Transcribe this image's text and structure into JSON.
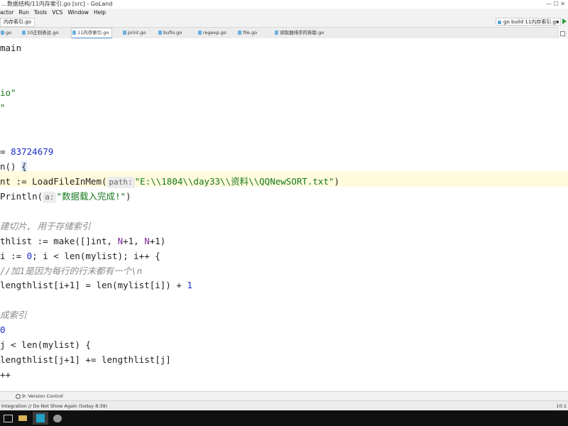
{
  "window": {
    "title": "…数据结构/11内存索引.go [src] - GoLand",
    "controls": "— ☐ ✕"
  },
  "menu": [
    "actor",
    "Run",
    "Tools",
    "VCS",
    "Window",
    "Help"
  ],
  "nav": {
    "breadcrumb": "内存索引.go",
    "run_config": "go build 11内存索引.go"
  },
  "tabs": [
    {
      "label": "go"
    },
    {
      "label": "10正则表达.go"
    },
    {
      "label": "11内存索引.go",
      "active": true
    },
    {
      "label": "print.go"
    },
    {
      "label": "bufio.go"
    },
    {
      "label": "regexp.go"
    },
    {
      "label": "file.go"
    },
    {
      "label": "读取器排序的排版.go"
    }
  ],
  "editor": {
    "lines": [
      {
        "parts": [
          {
            "t": "main"
          }
        ]
      },
      {
        "parts": []
      },
      {
        "parts": []
      },
      {
        "parts": [
          {
            "t": "io\"",
            "c": "str"
          }
        ]
      },
      {
        "parts": [
          {
            "t": "\"",
            "c": "str"
          }
        ]
      },
      {
        "parts": []
      },
      {
        "parts": []
      },
      {
        "parts": [
          {
            "t": "= "
          },
          {
            "t": "83724679",
            "c": "num"
          }
        ]
      },
      {
        "parts": [
          {
            "t": "n() "
          },
          {
            "t": "{",
            "c": "brace"
          }
        ]
      },
      {
        "parts": [
          {
            "t": "nt := LoadFileInMem("
          },
          {
            "t": "path:",
            "c": "hint"
          },
          {
            "t": "\"E:\\\\1804\\\\day33\\\\资料\\\\QQNewSORT.txt\"",
            "c": "str"
          },
          {
            "t": ")"
          }
        ]
      },
      {
        "parts": [
          {
            "t": "Println("
          },
          {
            "t": "a:",
            "c": "hint"
          },
          {
            "t": "\"数据载入完成!\"",
            "c": "str"
          },
          {
            "t": ")"
          }
        ]
      },
      {
        "parts": []
      },
      {
        "parts": [
          {
            "t": "建切片, 用于存储索引",
            "c": "cmt"
          }
        ]
      },
      {
        "parts": [
          {
            "t": "thlist := make([]int, "
          },
          {
            "t": "N",
            "c": "ident"
          },
          {
            "t": "+1, "
          },
          {
            "t": "N",
            "c": "ident"
          },
          {
            "t": "+1)"
          }
        ]
      },
      {
        "parts": [
          {
            "t": "i := "
          },
          {
            "t": "0",
            "c": "num"
          },
          {
            "t": "; i < len(mylist); i++ {"
          }
        ]
      },
      {
        "parts": [
          {
            "t": "//加1是因为每行的行末都有一个\\n",
            "c": "cmt"
          }
        ]
      },
      {
        "parts": [
          {
            "t": "lengthlist[i+1] = len(mylist[i]) + "
          },
          {
            "t": "1",
            "c": "num"
          }
        ]
      },
      {
        "parts": []
      },
      {
        "parts": [
          {
            "t": "成索引",
            "c": "cmt"
          }
        ]
      },
      {
        "parts": [
          {
            "t": "0",
            "c": "num"
          }
        ]
      },
      {
        "parts": [
          {
            "t": "j < len(mylist) {"
          }
        ]
      },
      {
        "parts": [
          {
            "t": "lengthlist[j+1] += lengthlist[j]"
          }
        ]
      },
      {
        "parts": [
          {
            "t": "++"
          }
        ]
      }
    ]
  },
  "bottom": {
    "version_control": "9: Version Control"
  },
  "status": {
    "message": "Integration // Do Not Show Again (today 8:39)",
    "position": "10:1"
  },
  "taskbar": {
    "clock": ""
  }
}
